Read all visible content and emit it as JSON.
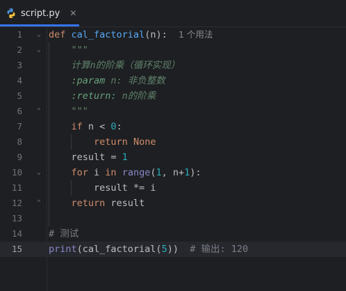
{
  "tab": {
    "filename": "script.py",
    "close_glyph": "✕"
  },
  "lines": [
    {
      "n": "1"
    },
    {
      "n": "2"
    },
    {
      "n": "3"
    },
    {
      "n": "4"
    },
    {
      "n": "5"
    },
    {
      "n": "6"
    },
    {
      "n": "7"
    },
    {
      "n": "8"
    },
    {
      "n": "9"
    },
    {
      "n": "10"
    },
    {
      "n": "11"
    },
    {
      "n": "12"
    },
    {
      "n": "13"
    },
    {
      "n": "14"
    },
    {
      "n": "15"
    }
  ],
  "code": {
    "l1_def": "def",
    "l1_name": "cal_factorial",
    "l1_rest": "(n):",
    "l1_hint": "1 个用法",
    "l2": "\"\"\"",
    "l3": "计算n的阶乘（循环实现）",
    "l4_tag": ":param",
    "l4_rest": " n: 非负整数",
    "l5_tag": ":return:",
    "l5_rest": " n的阶乘",
    "l6": "\"\"\"",
    "l7_if": "if",
    "l7_mid": " n < ",
    "l7_num": "0",
    "l7_end": ":",
    "l8_ret": "return",
    "l8_none": " None",
    "l9_a": "result = ",
    "l9_num": "1",
    "l10_for": "for",
    "l10_a": " i ",
    "l10_in": "in",
    "l10_b": " ",
    "l10_range": "range",
    "l10_c": "(",
    "l10_one": "1",
    "l10_d": ", n+",
    "l10_one2": "1",
    "l10_e": "):",
    "l11": "result *= i",
    "l12_ret": "return",
    "l12_rest": " result",
    "l14": "# 测试",
    "l15_print": "print",
    "l15_a": "(cal_factorial(",
    "l15_num": "5",
    "l15_b": "))",
    "l15_cmt": "  # 输出: 120"
  },
  "colors": {
    "background": "#1e1f22",
    "keyword": "#cf8e6d",
    "function": "#56a8f5",
    "number": "#2aacb8",
    "docstring": "#5f826b"
  }
}
